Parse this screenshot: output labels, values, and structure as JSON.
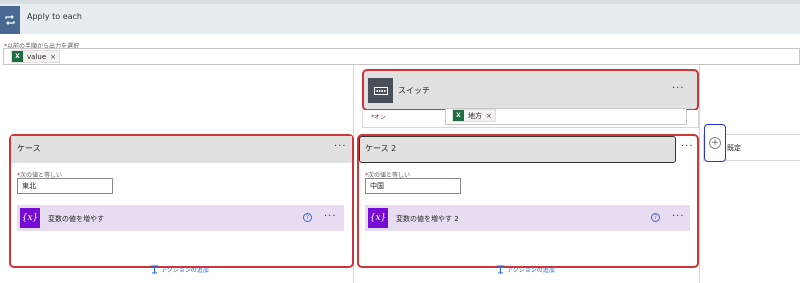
{
  "apply_to_each": {
    "title": "Apply to each"
  },
  "select_output": {
    "label": "以前の手順から出力を選択",
    "token": {
      "label": "value",
      "remove": "×"
    }
  },
  "switch": {
    "title": "スイッチ",
    "menu": "···",
    "on_label": "オン",
    "token": {
      "label": "地方",
      "remove": "×"
    }
  },
  "cases": [
    {
      "title": "ケース",
      "menu": "···",
      "equals_label": "次の値と等しい",
      "value": "東北",
      "action": {
        "title": "変数の値を増やす",
        "help": "?",
        "menu": "···"
      },
      "add_action": "アクションの追加"
    },
    {
      "title": "ケース 2",
      "menu": "···",
      "equals_label": "次の値と等しい",
      "value": "中国",
      "action": {
        "title": "変数の値を増やす 2",
        "help": "?",
        "menu": "···"
      },
      "add_action": "アクションの追加"
    }
  ],
  "default_case": {
    "title": "既定",
    "add": "+"
  },
  "required_mark": "*",
  "icons": [
    "loop-icon",
    "switch-icon",
    "excel-icon",
    "variable-icon",
    "help-icon",
    "add-action-icon",
    "plus-icon",
    "down-arrow-icon"
  ],
  "colors": {
    "danger_outline": "#d13438",
    "focus_outline": "#2a33d6",
    "loop_icon_bg": "#486991",
    "switch_icon_bg": "#484f58",
    "variable_icon_bg": "#770bd6",
    "variable_card_bg": "#e8dcf3",
    "excel_green": "#1d6f42"
  }
}
